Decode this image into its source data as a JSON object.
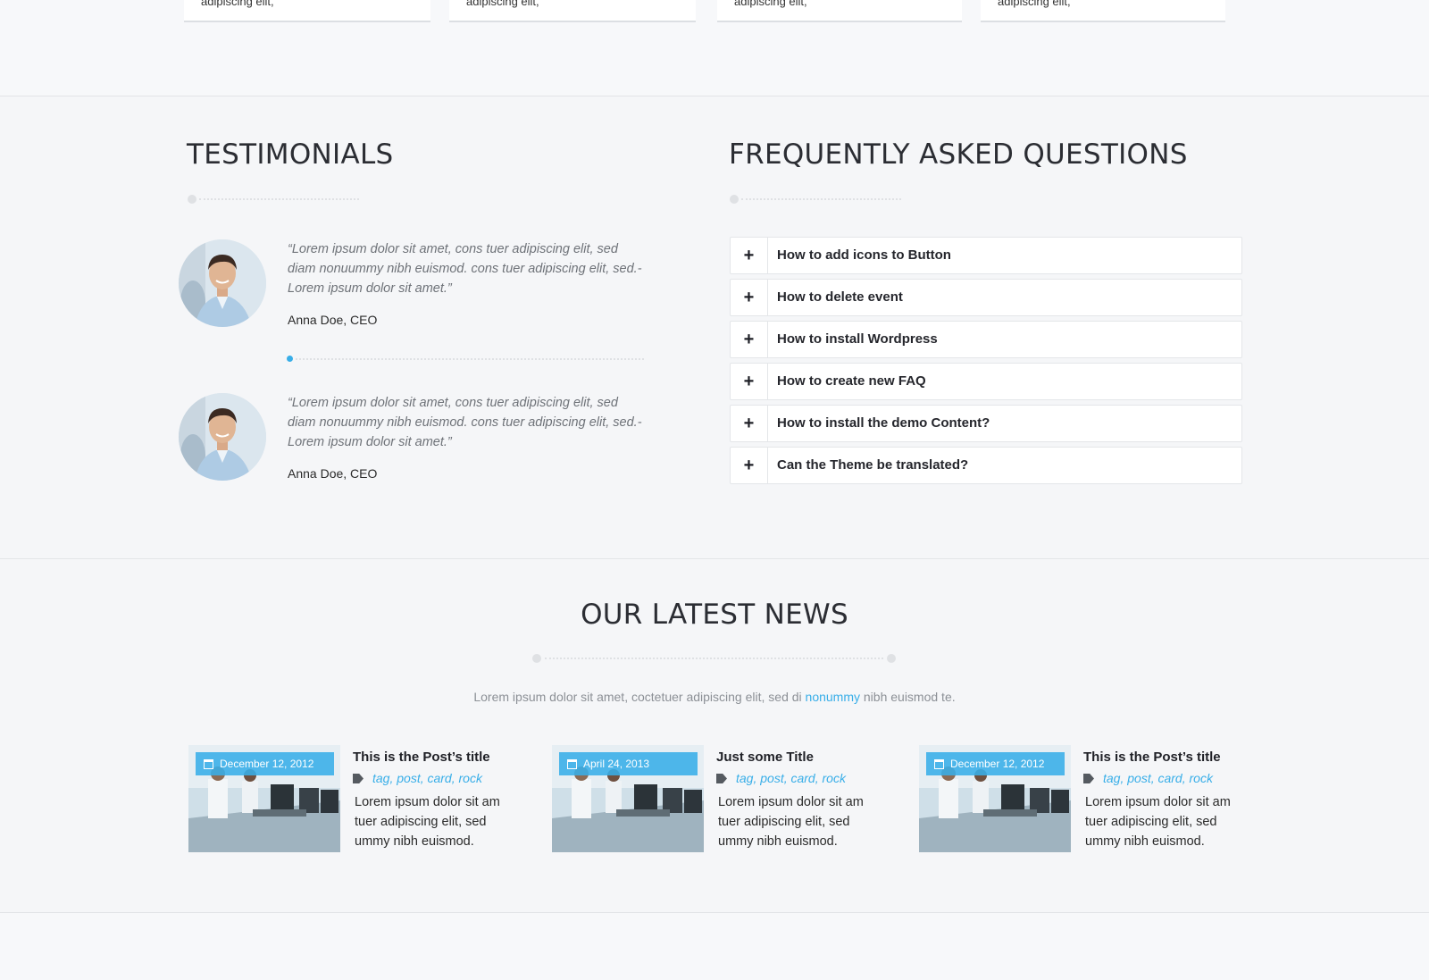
{
  "top_cards": [
    {
      "text": "adipiscing elit,"
    },
    {
      "text": "adipiscing elit,"
    },
    {
      "text": "adipiscing elit,"
    },
    {
      "text": "adipiscing elit,"
    }
  ],
  "testimonials": {
    "heading": "TESTIMONIALS",
    "items": [
      {
        "quote": "“Lorem ipsum dolor sit amet, cons tuer adipiscing elit, sed diam nonuummy nibh euismod. cons tuer adipiscing elit, sed.- Lorem ipsum dolor sit amet.”",
        "author": "Anna Doe, CEO"
      },
      {
        "quote": "“Lorem ipsum dolor sit amet, cons tuer adipiscing elit, sed diam nonuummy nibh euismod. cons tuer adipiscing elit, sed.- Lorem ipsum dolor sit amet.”",
        "author": "Anna Doe, CEO"
      }
    ]
  },
  "faq": {
    "heading": "FREQUENTLY ASKED QUESTIONS",
    "toggle_symbol": "+",
    "items": [
      {
        "question": "How to add icons to Button"
      },
      {
        "question": "How to delete event"
      },
      {
        "question": "How to install Wordpress"
      },
      {
        "question": "How to create new FAQ"
      },
      {
        "question": "How to install the demo Content?"
      },
      {
        "question": "Can the Theme be translated?"
      }
    ]
  },
  "news": {
    "heading": "OUR LATEST NEWS",
    "intro_before": "Lorem ipsum dolor sit amet, coctetuer adipiscing elit, sed di ",
    "intro_link": "nonummy",
    "intro_after": " nibh euismod te.",
    "posts": [
      {
        "date": "December 12, 2012",
        "title": "This is the Post’s title",
        "tags": "tag, post, card, rock",
        "excerpt": "Lorem ipsum dolor sit am tuer adipiscing elit, sed ummy nibh euismod."
      },
      {
        "date": "April 24, 2013",
        "title": "Just some Title",
        "tags": "tag, post, card, rock",
        "excerpt": "Lorem ipsum dolor sit am tuer adipiscing elit, sed ummy nibh euismod."
      },
      {
        "date": "December 12, 2012",
        "title": "This is the Post’s title",
        "tags": "tag, post, card, rock",
        "excerpt": "Lorem ipsum dolor sit am tuer adipiscing elit, sed ummy nibh euismod."
      }
    ]
  },
  "colors": {
    "accent": "#38aee8",
    "background": "#f5f6f8",
    "heading": "#2b2d33"
  }
}
